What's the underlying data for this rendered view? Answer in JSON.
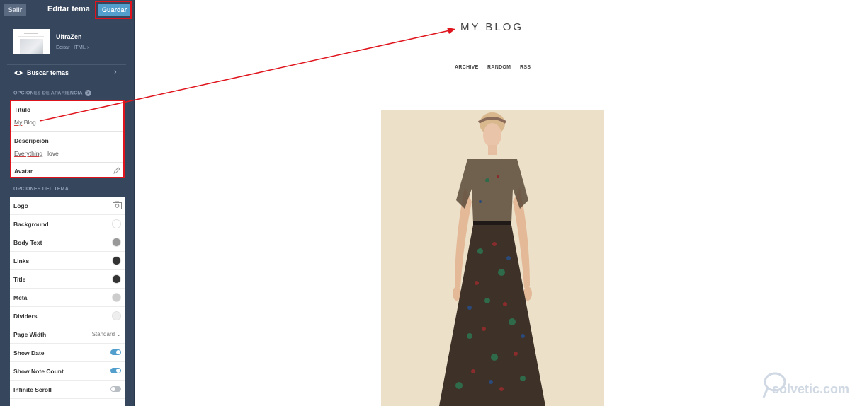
{
  "sidebar": {
    "exit_label": "Salir",
    "title": "Editar tema",
    "save_label": "Guardar",
    "theme": {
      "name": "UltraZen",
      "edit_html": "Editar HTML"
    },
    "browse_label": "Buscar temas",
    "appearance_section": "OPCIONES DE APARIENCIA",
    "fields": {
      "title_label": "Título",
      "title_value_a": "My",
      "title_value_b": " Blog",
      "desc_label": "Descripción",
      "desc_value_a": "Everything",
      "desc_value_b": " | love",
      "avatar_label": "Avatar"
    },
    "theme_options_section": "OPCIONES DEL TEMA",
    "options": [
      {
        "label": "Logo",
        "kind": "camera"
      },
      {
        "label": "Background",
        "kind": "color",
        "color": "#ffffff"
      },
      {
        "label": "Body Text",
        "kind": "color",
        "color": "#999999"
      },
      {
        "label": "Links",
        "kind": "color",
        "color": "#333333"
      },
      {
        "label": "Title",
        "kind": "color",
        "color": "#333333"
      },
      {
        "label": "Meta",
        "kind": "color",
        "color": "#cccccc"
      },
      {
        "label": "Dividers",
        "kind": "color",
        "color": "#eeeeee"
      },
      {
        "label": "Page Width",
        "kind": "select",
        "value": "Standard"
      },
      {
        "label": "Show Date",
        "kind": "toggle",
        "on": true
      },
      {
        "label": "Show Note Count",
        "kind": "toggle",
        "on": true
      },
      {
        "label": "Infinite Scroll",
        "kind": "toggle",
        "on": false
      }
    ]
  },
  "preview": {
    "blog_title": "MY BLOG",
    "nav": [
      "ARCHIVE",
      "RANDOM",
      "RSS"
    ]
  },
  "watermark": "solvetic.com",
  "colors": {
    "sidebar_bg": "#36465d",
    "accent": "#529ecc",
    "highlight": "#e0141c"
  }
}
